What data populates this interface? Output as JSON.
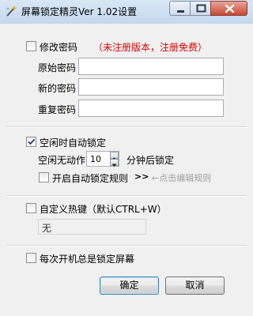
{
  "window": {
    "title": "屏幕锁定精灵Ver 1.02设置",
    "icon": "wand-icon",
    "controls": {
      "minimize": "minimize-icon",
      "maximize": "maximize-icon",
      "close": "close-icon"
    }
  },
  "password": {
    "checkbox_label": "修改密码",
    "checked": false,
    "notice": "（未注册版本，注册免费）",
    "notice_color": "#e00000",
    "fields": [
      {
        "label": "原始密码",
        "value": ""
      },
      {
        "label": "新的密码",
        "value": ""
      },
      {
        "label": "重复密码",
        "value": ""
      }
    ]
  },
  "idle_lock": {
    "checkbox_label": "空闲时自动锁定",
    "checked": true,
    "idle_prefix": "空闲无动作",
    "minutes": "10",
    "idle_suffix": "分钟后锁定",
    "rule_label": "开启自动锁定规则",
    "rule_checked": false,
    "arrows": ">>",
    "rule_hint": "←点击编辑规则"
  },
  "hotkey": {
    "checkbox_label": "自定义热键（默认CTRL+W）",
    "checked": false,
    "value": "无"
  },
  "startup": {
    "checkbox_label": "每次开机总是锁定屏幕",
    "checked": false
  },
  "buttons": {
    "ok": "确定",
    "cancel": "取消"
  }
}
